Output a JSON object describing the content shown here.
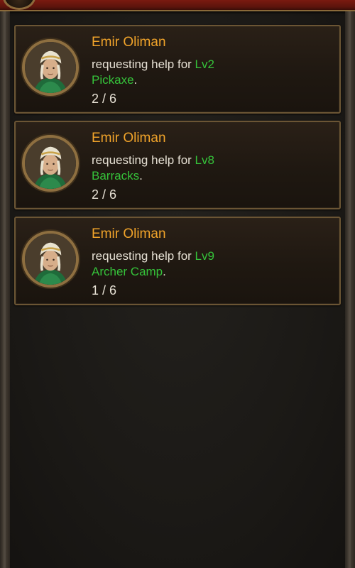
{
  "help_requests": [
    {
      "name": "Emir Oliman",
      "text": "requesting help for ",
      "level": "Lv2",
      "building": "Pickaxe",
      "suffix": ".",
      "progress": "2 / 6"
    },
    {
      "name": "Emir Oliman",
      "text": "requesting help for ",
      "level": "Lv8",
      "building": "Barracks",
      "suffix": ".",
      "progress": "2 / 6"
    },
    {
      "name": "Emir Oliman",
      "text": "requesting help for ",
      "level": "Lv9",
      "building": "Archer Camp",
      "suffix": ".",
      "progress": "1 / 6"
    }
  ],
  "colors": {
    "name": "#f0a32a",
    "highlight": "#35c23a",
    "text": "#e6e0d4",
    "card_border": "#6b5534",
    "header": "#7a1a10"
  },
  "icons": {
    "avatar": "hero-portrait-icon"
  }
}
